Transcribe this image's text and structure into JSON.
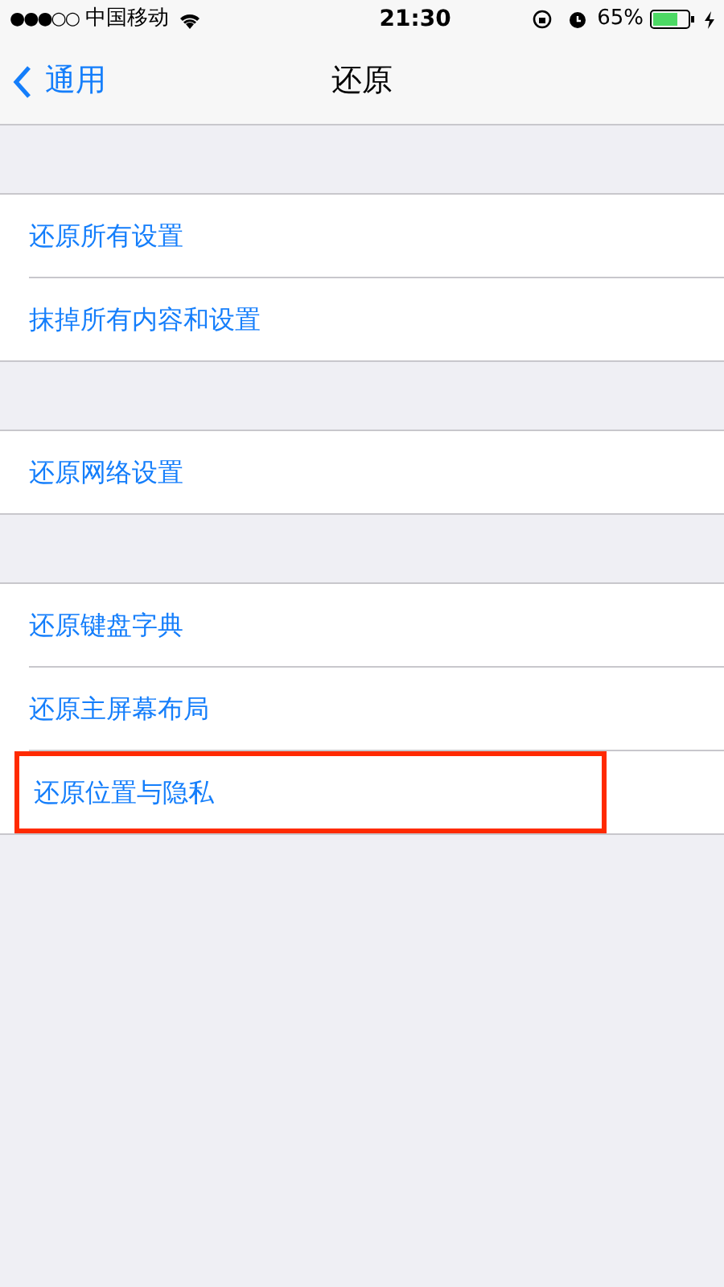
{
  "status_bar": {
    "signal": "●●●○○",
    "carrier": "中国移动",
    "time": "21:30",
    "battery_percent": "65%"
  },
  "nav": {
    "back": "通用",
    "title": "还原"
  },
  "groups": [
    {
      "items": [
        {
          "label": "还原所有设置",
          "highlighted": false
        },
        {
          "label": "抹掉所有内容和设置",
          "highlighted": false
        }
      ]
    },
    {
      "items": [
        {
          "label": "还原网络设置",
          "highlighted": false
        }
      ]
    },
    {
      "items": [
        {
          "label": "还原键盘字典",
          "highlighted": false
        },
        {
          "label": "还原主屏幕布局",
          "highlighted": false
        },
        {
          "label": "还原位置与隐私",
          "highlighted": true
        }
      ]
    }
  ]
}
